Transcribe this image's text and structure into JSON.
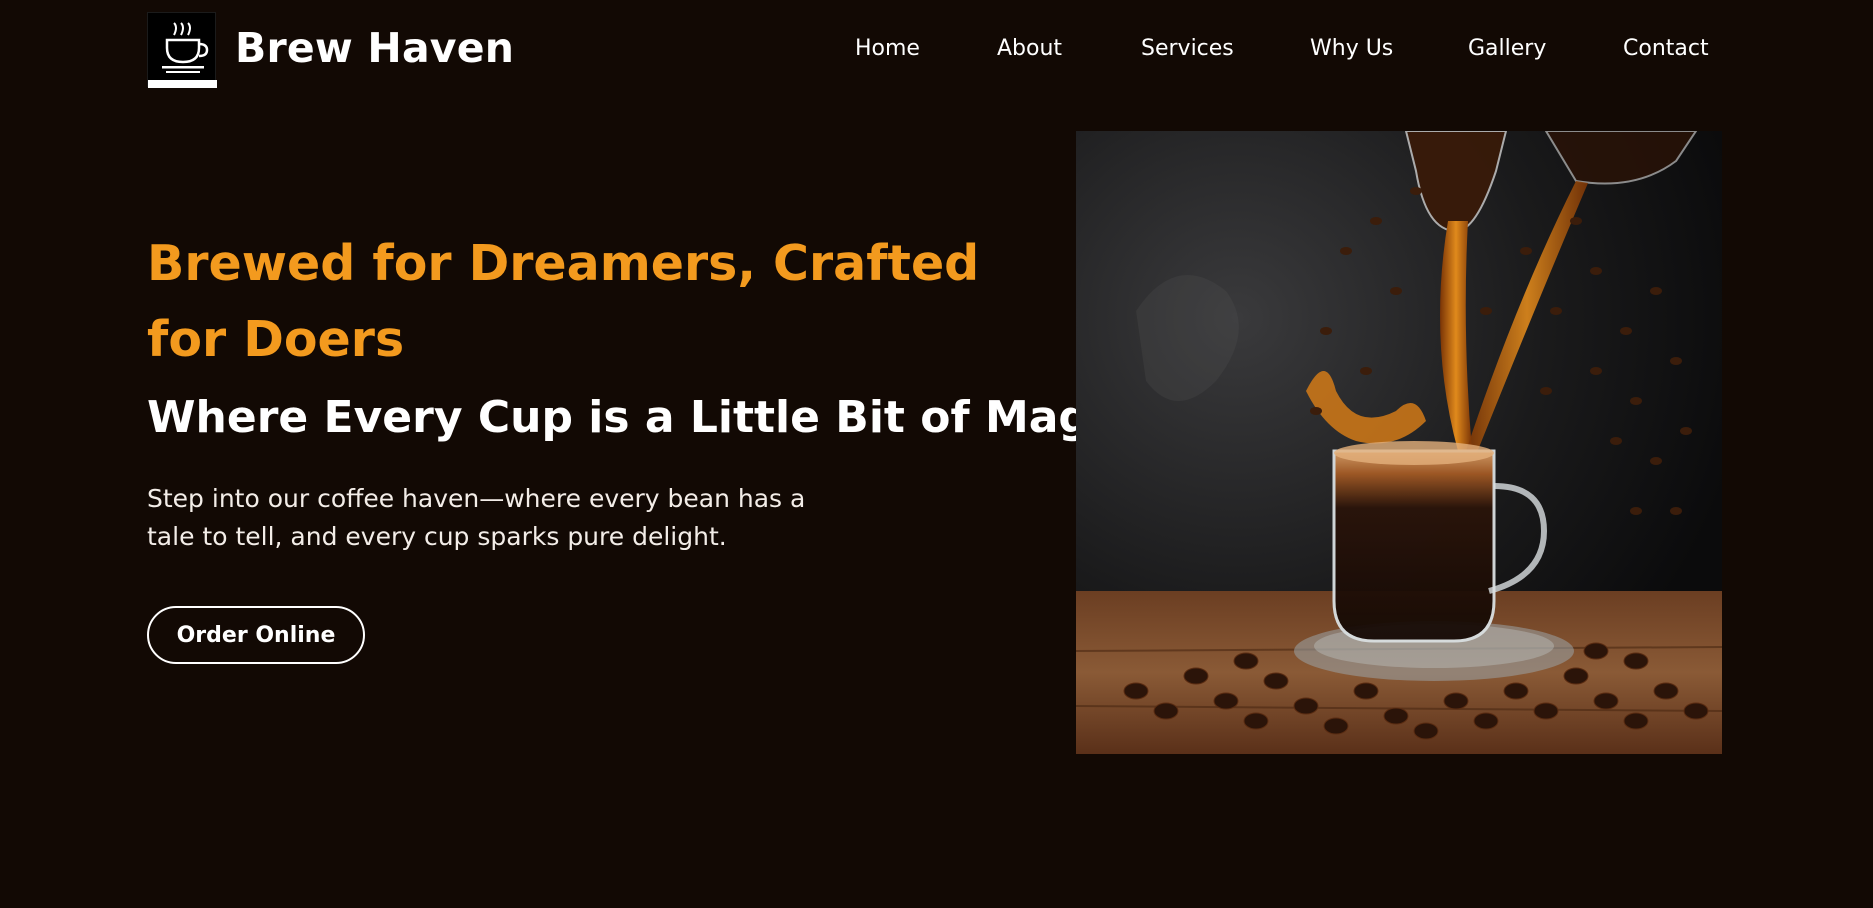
{
  "header": {
    "brand": "Brew Haven",
    "logo_icon": "coffee-cup-logo",
    "nav": [
      {
        "label": "Home"
      },
      {
        "label": "About"
      },
      {
        "label": "Services"
      },
      {
        "label": "Why Us"
      },
      {
        "label": "Gallery"
      },
      {
        "label": "Contact"
      }
    ]
  },
  "hero": {
    "title": "Brewed for Dreamers, Crafted for Doers",
    "subtitle": "Where Every Cup is a Little Bit of Magic",
    "description": "Step into our coffee haven—where every bean has a tale to tell, and every cup sparks pure delight.",
    "cta_label": "Order Online",
    "image_subject": "coffee-pour-photo"
  },
  "colors": {
    "background": "#120904",
    "accent": "#f39a1e",
    "text": "#ffffff"
  }
}
